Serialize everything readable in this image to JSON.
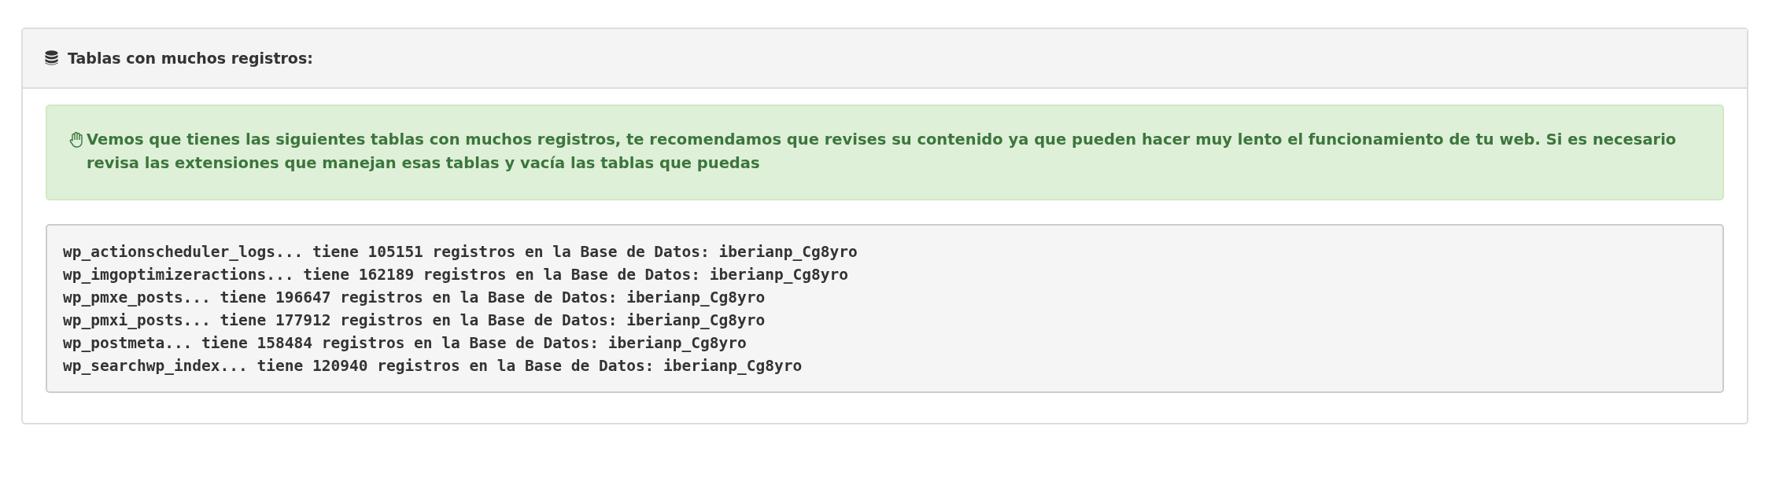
{
  "panel": {
    "title": "Tablas con muchos registros:"
  },
  "alert": {
    "text": "Vemos que tienes las siguientes tablas con muchos registros, te recomendamos que revises su contenido ya que pueden hacer muy lento el funcionamiento de tu web. Si es necesario revisa las extensiones que manejan esas tablas y vacía las tablas que puedas"
  },
  "log_lines": [
    "wp_actionscheduler_logs... tiene 105151 registros en la Base de Datos: iberianp_Cg8yro",
    "wp_imgoptimizeractions... tiene 162189 registros en la Base de Datos: iberianp_Cg8yro",
    "wp_pmxe_posts... tiene 196647 registros en la Base de Datos: iberianp_Cg8yro",
    "wp_pmxi_posts... tiene 177912 registros en la Base de Datos: iberianp_Cg8yro",
    "wp_postmeta... tiene 158484 registros en la Base de Datos: iberianp_Cg8yro",
    "wp_searchwp_index... tiene 120940 registros en la Base de Datos: iberianp_Cg8yro"
  ]
}
